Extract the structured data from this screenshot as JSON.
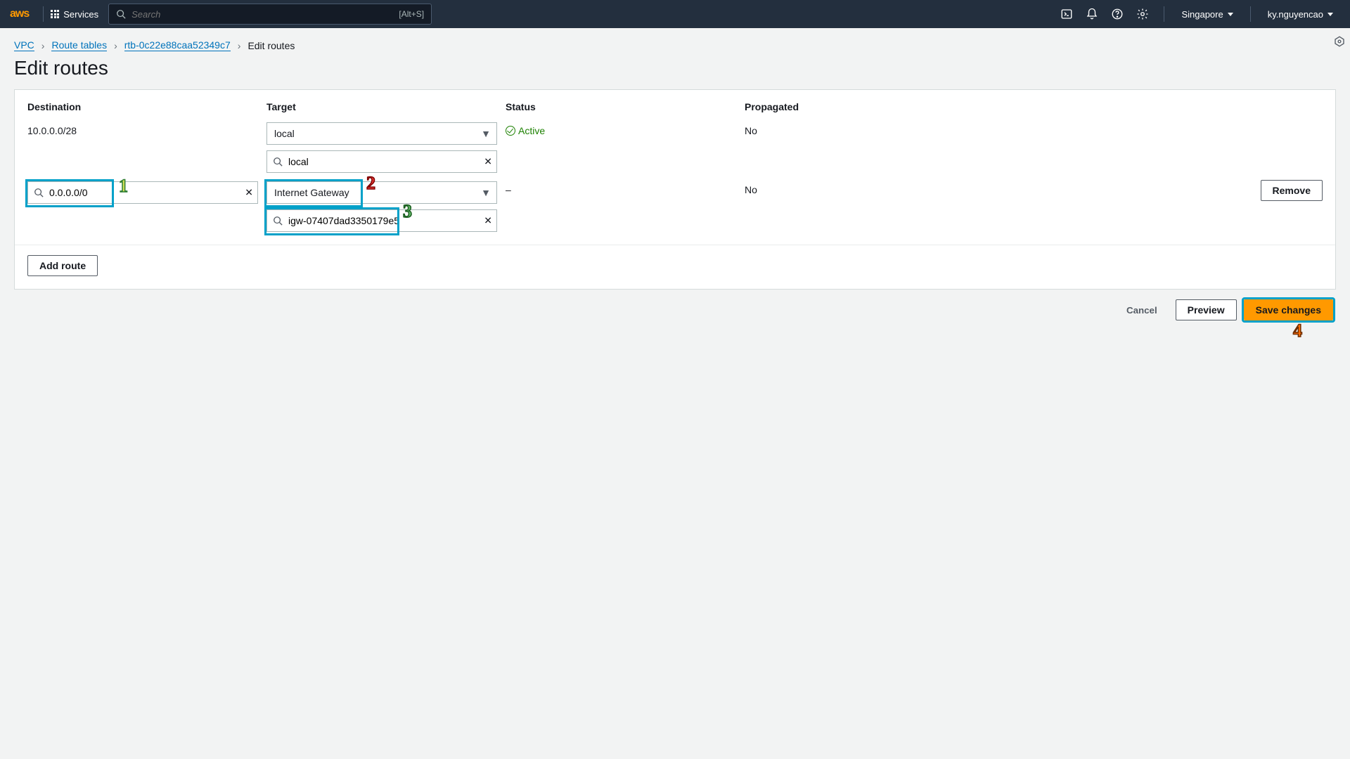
{
  "nav": {
    "logo": "aws",
    "services": "Services",
    "search_placeholder": "Search",
    "search_hint": "[Alt+S]",
    "region": "Singapore",
    "user": "ky.nguyencao"
  },
  "breadcrumb": {
    "vpc": "VPC",
    "route_tables": "Route tables",
    "rtb_id": "rtb-0c22e88caa52349c7",
    "current": "Edit routes"
  },
  "page_title": "Edit routes",
  "headers": {
    "destination": "Destination",
    "target": "Target",
    "status": "Status",
    "propagated": "Propagated"
  },
  "routes": [
    {
      "destination_text": "10.0.0.0/28",
      "target_select": "local",
      "target_search": "local",
      "status": "Active",
      "propagated": "No"
    },
    {
      "destination_input": "0.0.0.0/0",
      "target_select": "Internet Gateway",
      "target_search": "igw-07407dad3350179e5",
      "status": "–",
      "propagated": "No",
      "remove": "Remove"
    }
  ],
  "buttons": {
    "add_route": "Add route",
    "cancel": "Cancel",
    "preview": "Preview",
    "save": "Save changes"
  },
  "annotations": {
    "a1": "1",
    "a2": "2",
    "a3": "3",
    "a4": "4"
  }
}
